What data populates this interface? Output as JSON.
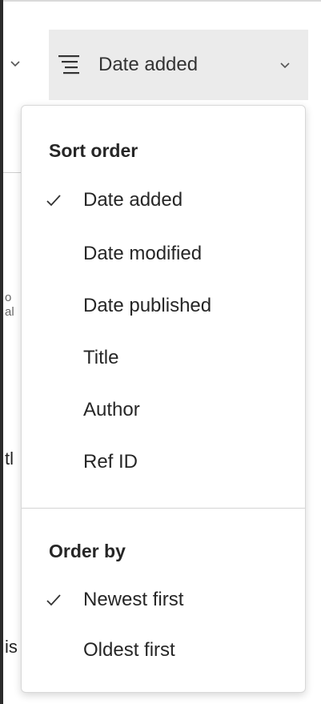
{
  "toolbar": {
    "sort_label": "Date added",
    "sort_icon": "sort-lines-icon",
    "chevron_icon": "chevron-down-icon"
  },
  "background_fragments": {
    "line1": "o",
    "line2": "al",
    "line3": "tl",
    "line4": "is"
  },
  "menu": {
    "sort_order": {
      "title": "Sort order",
      "items": [
        {
          "label": "Date added",
          "checked": true
        },
        {
          "label": "Date modified",
          "checked": false
        },
        {
          "label": "Date published",
          "checked": false
        },
        {
          "label": "Title",
          "checked": false
        },
        {
          "label": "Author",
          "checked": false
        },
        {
          "label": "Ref ID",
          "checked": false
        }
      ]
    },
    "order_by": {
      "title": "Order by",
      "items": [
        {
          "label": "Newest first",
          "checked": true
        },
        {
          "label": "Oldest first",
          "checked": false
        }
      ]
    }
  },
  "colors": {
    "button_bg": "#ebebeb",
    "text": "#262626",
    "border": "#d8d8d8"
  }
}
